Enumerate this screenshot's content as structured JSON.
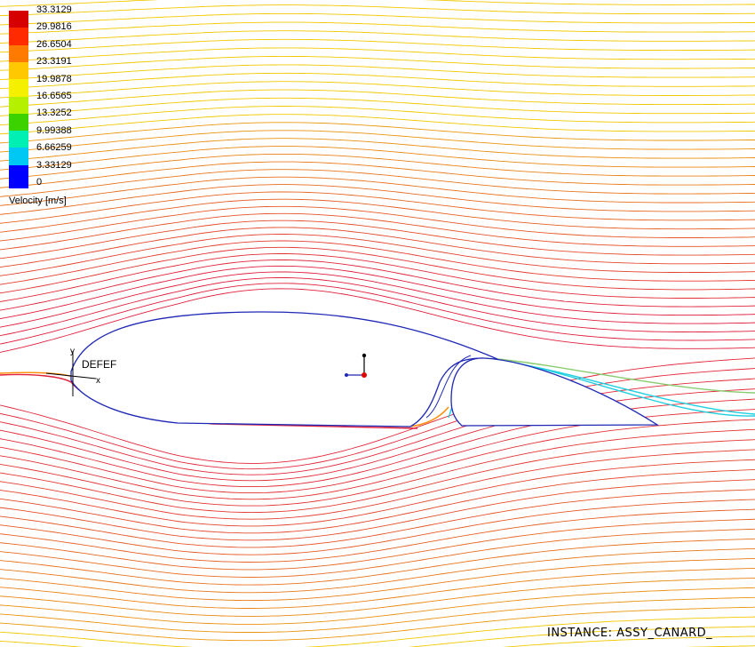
{
  "legend": {
    "title": "Velocity [m/s]",
    "ticks": [
      "33.3129",
      "29.9816",
      "26.6504",
      "23.3191",
      "19.9878",
      "16.6565",
      "13.3252",
      "9.99388",
      "6.66259",
      "3.33129",
      "0"
    ],
    "colors": [
      "#d70000",
      "#ff2a00",
      "#ff7a00",
      "#ffc800",
      "#f5f000",
      "#b4f000",
      "#3cd200",
      "#00f0b4",
      "#00c8f5",
      "#0078ff",
      "#0000ff"
    ]
  },
  "triad": {
    "y_label": "y",
    "x_label": "x",
    "tag": "DEFEF"
  },
  "instance_label": "INSTANCE: ASSY_CANARD_",
  "plot": {
    "type": "streamline-velocity-contour",
    "quantity": "Velocity",
    "unit": "m/s",
    "range": [
      0,
      33.3129
    ],
    "colors": {
      "freestream": "#f0c800",
      "fast": "#e0203c",
      "medium": "#ff8a00",
      "surface": "#1e28b4",
      "wake": "#20d0e0",
      "background": "#ffffff"
    }
  }
}
